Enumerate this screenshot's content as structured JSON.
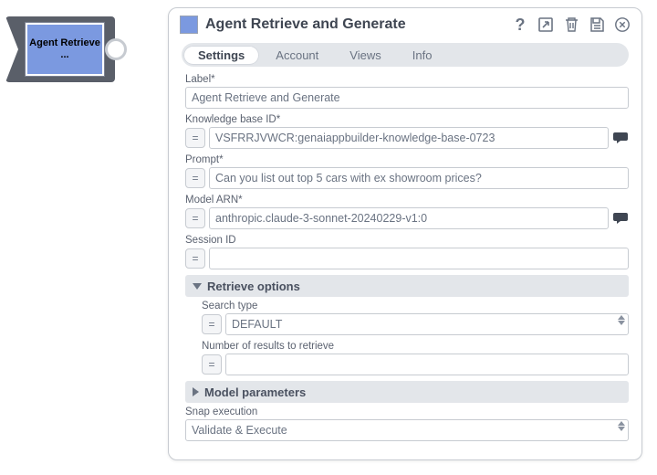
{
  "node": {
    "label": "Agent Retrieve ..."
  },
  "header": {
    "title": "Agent Retrieve and Generate"
  },
  "tabs": {
    "t0": "Settings",
    "t1": "Account",
    "t2": "Views",
    "t3": "Info"
  },
  "fields": {
    "label": {
      "lbl": "Label*",
      "val": "Agent Retrieve and Generate"
    },
    "kb": {
      "lbl": "Knowledge base ID*",
      "val": "VSFRRJVWCR:genaiappbuilder-knowledge-base-0723"
    },
    "prompt": {
      "lbl": "Prompt*",
      "val": "Can you list out top 5 cars with ex showroom prices?"
    },
    "model": {
      "lbl": "Model ARN*",
      "val": "anthropic.claude-3-sonnet-20240229-v1:0"
    },
    "session": {
      "lbl": "Session ID",
      "val": ""
    },
    "searchtype": {
      "lbl": "Search type",
      "val": "DEFAULT"
    },
    "numresults": {
      "lbl": "Number of results to retrieve",
      "val": ""
    },
    "snapexec": {
      "lbl": "Snap execution",
      "val": "Validate & Execute"
    }
  },
  "sections": {
    "retrieve": "Retrieve options",
    "modelparams": "Model parameters"
  },
  "glyph": {
    "eq": "=",
    "help": "?"
  }
}
